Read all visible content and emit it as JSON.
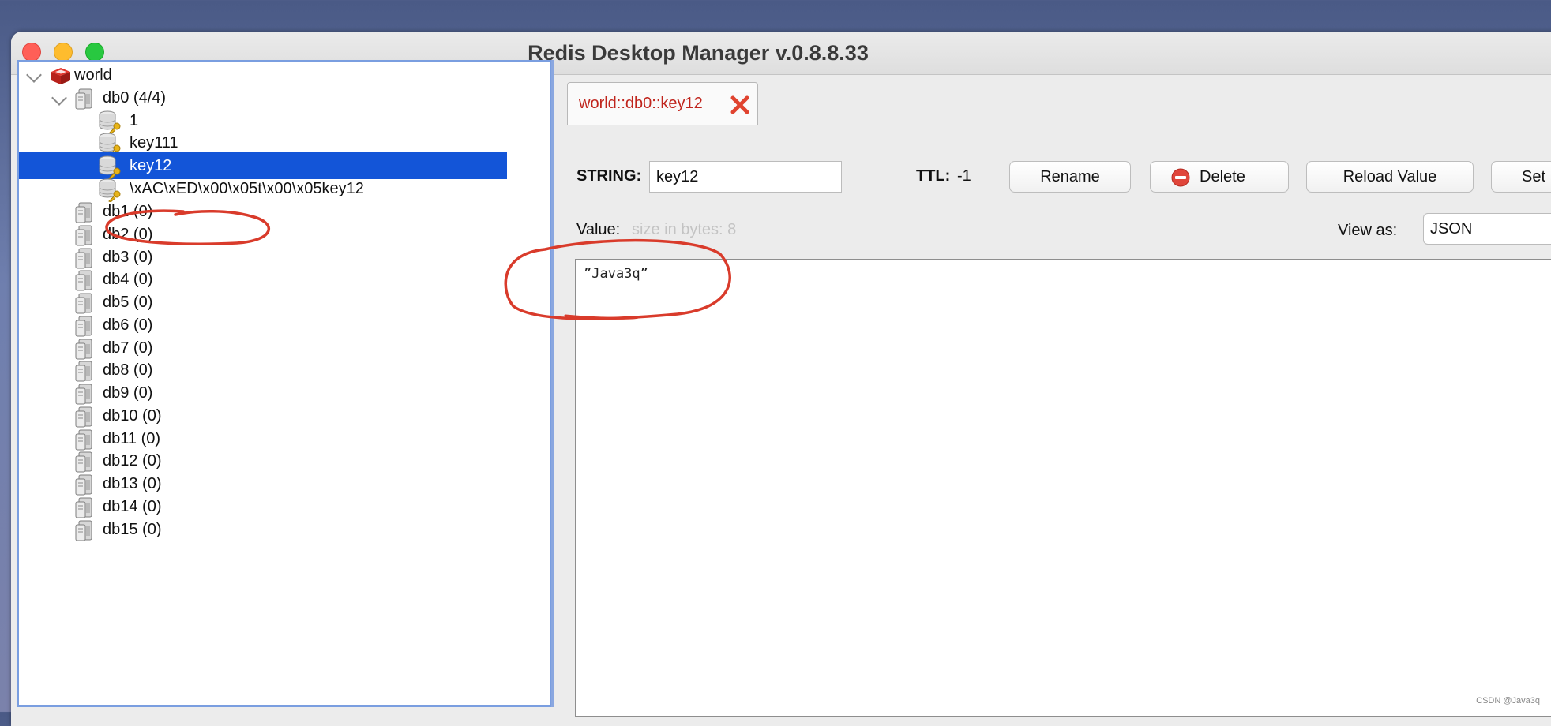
{
  "window": {
    "title": "Redis Desktop Manager v.0.8.8.33"
  },
  "tree": {
    "server": "world",
    "db0": "db0  (4/4)",
    "keys": [
      "1",
      "key111",
      "key12",
      "\\xAC\\xED\\x00\\x05t\\x00\\x05key12"
    ],
    "selected_key": "key12",
    "databases": [
      "db1 (0)",
      "db2 (0)",
      "db3 (0)",
      "db4 (0)",
      "db5 (0)",
      "db6 (0)",
      "db7 (0)",
      "db8 (0)",
      "db9 (0)",
      "db10 (0)",
      "db11 (0)",
      "db12 (0)",
      "db13 (0)",
      "db14 (0)",
      "db15 (0)"
    ]
  },
  "tab": {
    "label": "world::db0::key12"
  },
  "key_view": {
    "type_label": "STRING:",
    "key_name": "key12",
    "ttl_label": "TTL:",
    "ttl_value": "-1",
    "rename_label": "Rename",
    "delete_label": "Delete",
    "reload_label": "Reload Value",
    "set_label": "Set",
    "value_label": "Value:",
    "size_hint": "size in bytes: 8",
    "view_as_label": "View as:",
    "view_as_value": "JSON",
    "value_text": "”Java3q”"
  },
  "watermark": "CSDN @Java3q",
  "colors": {
    "selection": "#1355d8",
    "tab_text": "#c0251d",
    "annotation": "#d93b2b"
  }
}
